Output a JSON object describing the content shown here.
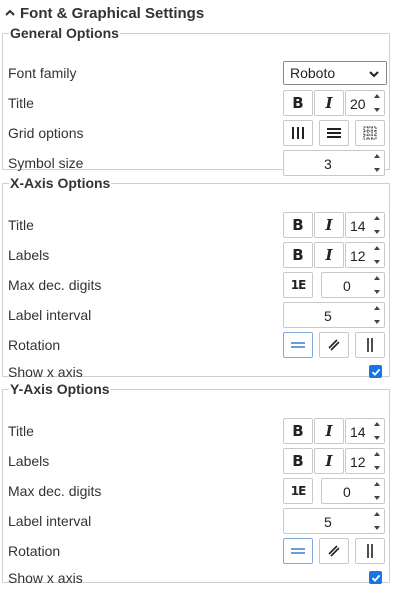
{
  "panel": {
    "title": "Font & Graphical Settings"
  },
  "general": {
    "legend": "General Options",
    "font_family_label": "Font family",
    "font_family_value": "Roboto",
    "title_label": "Title",
    "title_size": "20",
    "grid_label": "Grid options",
    "symbol_label": "Symbol size",
    "symbol_size": "3"
  },
  "xaxis": {
    "legend": "X-Axis Options",
    "title_label": "Title",
    "title_size": "14",
    "labels_label": "Labels",
    "labels_size": "12",
    "maxdec_label": "Max dec. digits",
    "maxdec_value": "0",
    "exp_label": "1E",
    "interval_label": "Label interval",
    "interval_value": "5",
    "rotation_label": "Rotation",
    "show_label": "Show x axis",
    "show_checked": true
  },
  "yaxis": {
    "legend": "Y-Axis Options",
    "title_label": "Title",
    "title_size": "14",
    "labels_label": "Labels",
    "labels_size": "12",
    "maxdec_label": "Max dec. digits",
    "maxdec_value": "0",
    "exp_label": "1E",
    "interval_label": "Label interval",
    "interval_value": "5",
    "rotation_label": "Rotation",
    "show_label": "Show x axis",
    "show_checked": true
  },
  "buttons": {
    "bold": "B",
    "italic": "I"
  },
  "colors": {
    "accent": "#1a73e8",
    "border": "#cfcfcf",
    "rotation_active": "#3b78d8"
  }
}
